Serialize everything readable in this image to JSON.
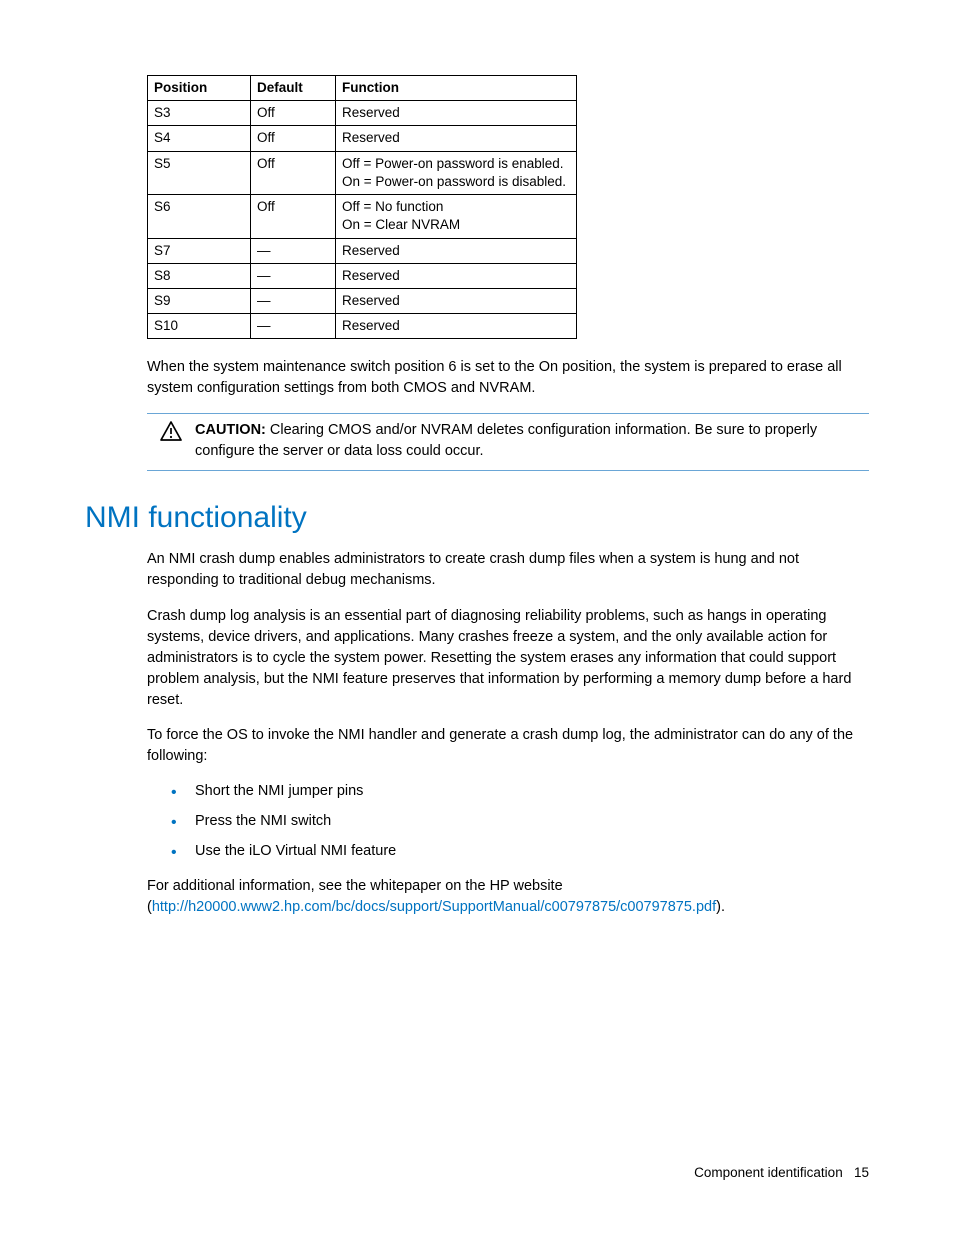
{
  "table": {
    "headers": {
      "position": "Position",
      "default": "Default",
      "function": "Function"
    },
    "rows": [
      {
        "position": "S3",
        "default": "Off",
        "function": "Reserved"
      },
      {
        "position": "S4",
        "default": "Off",
        "function": "Reserved"
      },
      {
        "position": "S5",
        "default": "Off",
        "function": "Off = Power-on password is enabled.\nOn = Power-on password is disabled."
      },
      {
        "position": "S6",
        "default": "Off",
        "function": "Off = No function\nOn = Clear NVRAM"
      },
      {
        "position": "S7",
        "default": "—",
        "function": "Reserved"
      },
      {
        "position": "S8",
        "default": "—",
        "function": "Reserved"
      },
      {
        "position": "S9",
        "default": "—",
        "function": "Reserved"
      },
      {
        "position": "S10",
        "default": "—",
        "function": "Reserved"
      }
    ]
  },
  "para1": "When the system maintenance switch position 6 is set to the On position, the system is prepared to erase all system configuration settings from both CMOS and NVRAM.",
  "caution": {
    "label": "CAUTION:",
    "text": "Clearing CMOS and/or NVRAM deletes configuration information. Be sure to properly configure the server or data loss could occur."
  },
  "section_title": "NMI functionality",
  "nmi_p1": "An NMI crash dump enables administrators to create crash dump files when a system is hung and not responding to traditional debug mechanisms.",
  "nmi_p2": "Crash dump log analysis is an essential part of diagnosing reliability problems, such as hangs in operating systems, device drivers, and applications. Many crashes freeze a system, and the only available action for administrators is to cycle the system power. Resetting the system erases any information that could support problem analysis, but the NMI feature preserves that information by performing a memory dump before a hard reset.",
  "nmi_p3": "To force the OS to invoke the NMI handler and generate a crash dump log, the administrator can do any of the following:",
  "bullets": [
    "Short the NMI jumper pins",
    "Press the NMI switch",
    "Use the iLO Virtual NMI feature"
  ],
  "nmi_p4_pre": "For additional information, see the whitepaper on the HP website (",
  "nmi_p4_link": "http://h20000.www2.hp.com/bc/docs/support/SupportManual/c00797875/c00797875.pdf",
  "nmi_p4_post": ").",
  "footer": {
    "section": "Component identification",
    "page": "15"
  }
}
